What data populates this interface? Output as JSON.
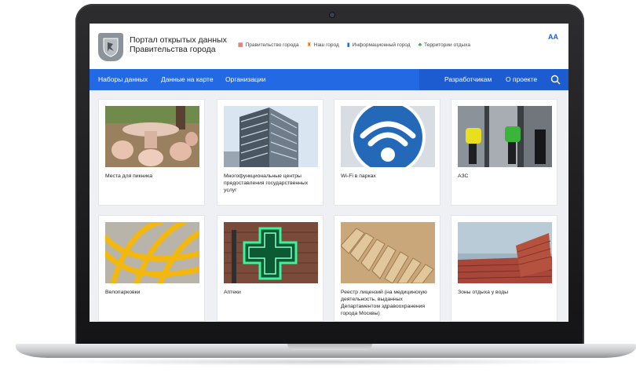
{
  "header": {
    "title_line1": "Портал открытых данных",
    "title_line2": "Правительства  города",
    "font_toggle": "AA",
    "links": [
      {
        "label": "Правительство города",
        "icon": "building-icon",
        "color": "#d23a3a"
      },
      {
        "label": "Наш город",
        "icon": "kremlin-icon",
        "color": "#e07b1a"
      },
      {
        "label": "Информационный город",
        "icon": "chart-icon",
        "color": "#2369e3"
      },
      {
        "label": "Территории отдыха",
        "icon": "tree-icon",
        "color": "#3aa346"
      }
    ]
  },
  "nav": {
    "left": [
      "Наборы данных",
      "Данные на карте",
      "Организации"
    ],
    "right": [
      "Разработчикам",
      "О проекте"
    ],
    "color": "#2369e3"
  },
  "cards": [
    {
      "title": "Места для пикника",
      "image": "picnic-table-photo"
    },
    {
      "title": "Многофункциональные центры предоставления государственных услуг",
      "image": "office-building-photo"
    },
    {
      "title": "Wi-Fi в парках",
      "image": "wifi-sign-photo"
    },
    {
      "title": "АЗС",
      "image": "fuel-pumps-photo"
    },
    {
      "title": "Велопарковки",
      "image": "bike-rack-photo"
    },
    {
      "title": "Аптеки",
      "image": "pharmacy-cross-photo"
    },
    {
      "title": "Реестр лицензий (на медицинскую деятельность, выданных Департаментом здравоохранения города Москвы)",
      "image": "file-folders-photo"
    },
    {
      "title": "Зоны отдыха у воды",
      "image": "waterfront-bench-photo"
    }
  ]
}
